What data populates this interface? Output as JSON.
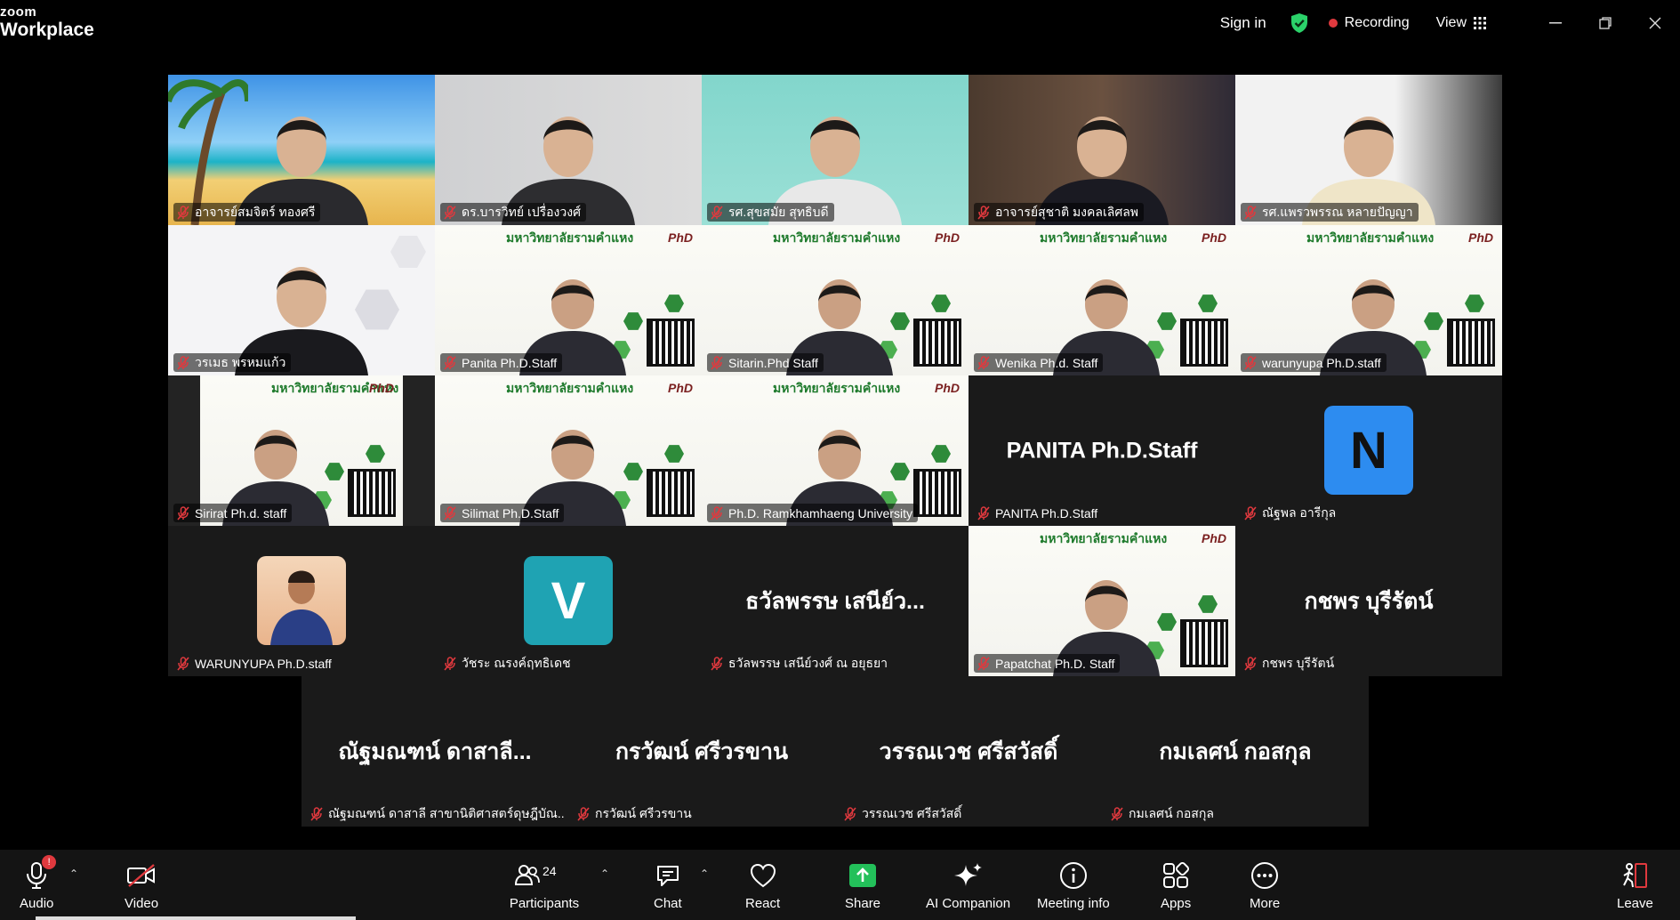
{
  "app": {
    "logo_top": "zoom",
    "logo_bottom": "Workplace"
  },
  "topbar": {
    "signin": "Sign in",
    "recording": "Recording",
    "view": "View"
  },
  "participants": [
    {
      "name": "อาจารย์สมจิตร์ ทองศรี",
      "kind": "beach"
    },
    {
      "name": "ดร.บารวิทย์ เปรื่องวงศ์",
      "kind": "gray"
    },
    {
      "name": "รศ.สุขสมัย สุทธิบดี",
      "kind": "teal"
    },
    {
      "name": "อาจารย์สุชาติ มงคลเลิศลพ",
      "kind": "office"
    },
    {
      "name": "รศ.แพรวพรรณ หลายปัญญา",
      "kind": "white"
    },
    {
      "name": "วรเมธ พรหมแก้ว",
      "kind": "hexwhite"
    },
    {
      "name": "Panita Ph.D.Staff",
      "kind": "slide"
    },
    {
      "name": "Sitarin.Phd Staff",
      "kind": "slide"
    },
    {
      "name": "Wenika Ph.d. Staff",
      "kind": "slide"
    },
    {
      "name": "warunyupa Ph.D.staff",
      "kind": "slide"
    },
    {
      "name": "Sirirat Ph.d. staff",
      "kind": "slide-narrow"
    },
    {
      "name": "Silimat Ph.D.Staff",
      "kind": "slide"
    },
    {
      "name": "Ph.D. Ramkhamhaeng University",
      "kind": "slide"
    },
    {
      "name": "PANITA Ph.D.Staff",
      "kind": "name",
      "display": "PANITA Ph.D.Staff"
    },
    {
      "name": "ณัฐพล อารีกุล",
      "kind": "letter",
      "letter": "N",
      "color": "#2d8cf0",
      "letter_color": "#111111"
    },
    {
      "name": "WARUNYUPA Ph.D.staff",
      "kind": "photo"
    },
    {
      "name": "วัชระ ณรงค์ฤทธิเดช",
      "kind": "letter",
      "letter": "V",
      "color": "#1fa3b3",
      "letter_color": "#ffffff"
    },
    {
      "name": "ธวัลพรรษ เสนีย์วงศ์ ณ อยุธยา",
      "kind": "name",
      "display": "ธวัลพรรษ เสนีย์ว..."
    },
    {
      "name": "Papatchat Ph.D. Staff",
      "kind": "slide"
    },
    {
      "name": "กชพร บุรีรัตน์",
      "kind": "name",
      "display": "กชพร บุรีรัตน์"
    },
    {
      "name": "ณัฐมณฑน์ ดาสาลี สาขานิติศาสตร์ดุษฎีบัณ...",
      "kind": "name",
      "display": "ณัฐมณฑน์ ดาสาลี..."
    },
    {
      "name": "กรวัฒน์ ศรีวรขาน",
      "kind": "name",
      "display": "กรวัฒน์ ศรีวรขาน"
    },
    {
      "name": "วรรณเวช ศรีสวัสดิ์",
      "kind": "name",
      "display": "วรรณเวช ศรีสวัสดิ์"
    },
    {
      "name": "กมเลศน์ กอสกุล",
      "kind": "name",
      "display": "กมเลศน์ กอสกุล"
    }
  ],
  "slide": {
    "header": "มหาวิทยาลัยรามคำแหง",
    "logo": "PhD"
  },
  "toolbar": {
    "audio": "Audio",
    "audio_badge": "!",
    "video": "Video",
    "participants": "Participants",
    "participants_count": "24",
    "chat": "Chat",
    "react": "React",
    "share": "Share",
    "ai": "AI Companion",
    "info": "Meeting info",
    "apps": "Apps",
    "more": "More",
    "leave": "Leave"
  },
  "colors": {
    "accent_green": "#2bd26a",
    "recording_red": "#e0393e",
    "share_green": "#23c05a",
    "leave_red": "#e0393e"
  }
}
